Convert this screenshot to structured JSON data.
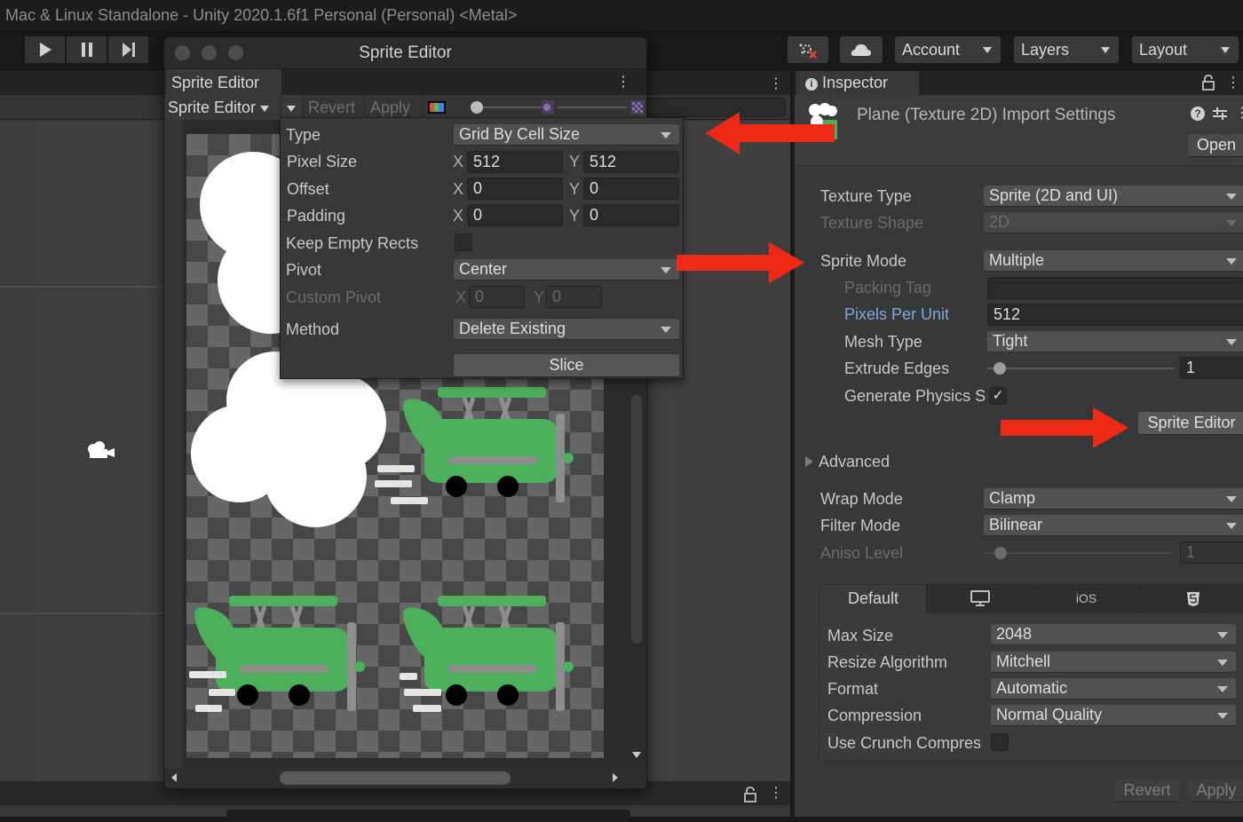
{
  "window_title": "Mac & Linux Standalone - Unity 2020.1.6f1 Personal (Personal) <Metal>",
  "toolbar": {
    "play_icon": "play-icon",
    "pause_icon": "pause-icon",
    "step_icon": "step-icon",
    "collab_icon": "collab-icon",
    "cloud_icon": "cloud-icon",
    "account_label": "Account",
    "layers_label": "Layers",
    "layout_label": "Layout"
  },
  "sprite_editor": {
    "window_title": "Sprite Editor",
    "tab_label": "Sprite Editor",
    "mode_dropdown": "Sprite Editor",
    "slice_menu_icon": "slice-dropdown-icon",
    "revert_label": "Revert",
    "apply_label": "Apply",
    "color_channel_icon": "rgb-channel-icon",
    "zoom_slider_value": 0,
    "mip_slider_value": 0
  },
  "slice_popup": {
    "type_label": "Type",
    "type_value": "Grid By Cell Size",
    "pixel_size_label": "Pixel Size",
    "pixel_size_x": "512",
    "pixel_size_y": "512",
    "offset_label": "Offset",
    "offset_x": "0",
    "offset_y": "0",
    "padding_label": "Padding",
    "padding_x": "0",
    "padding_y": "0",
    "keep_empty_label": "Keep Empty Rects",
    "keep_empty_checked": false,
    "pivot_label": "Pivot",
    "pivot_value": "Center",
    "custom_pivot_label": "Custom Pivot",
    "custom_pivot_x": "0",
    "custom_pivot_y": "0",
    "method_label": "Method",
    "method_value": "Delete Existing",
    "slice_button": "Slice",
    "x_axis": "X",
    "y_axis": "Y"
  },
  "inspector": {
    "tab_label": "Inspector",
    "title": "Plane (Texture 2D) Import Settings",
    "open_button": "Open",
    "fields": {
      "texture_type_label": "Texture Type",
      "texture_type_value": "Sprite (2D and UI)",
      "texture_shape_label": "Texture Shape",
      "texture_shape_value": "2D",
      "sprite_mode_label": "Sprite Mode",
      "sprite_mode_value": "Multiple",
      "packing_tag_label": "Packing Tag",
      "packing_tag_value": "",
      "ppu_label": "Pixels Per Unit",
      "ppu_value": "512",
      "mesh_type_label": "Mesh Type",
      "mesh_type_value": "Tight",
      "extrude_label": "Extrude Edges",
      "extrude_value": "1",
      "gen_physics_label": "Generate Physics S",
      "gen_physics_checked": true,
      "check_mark": "✓",
      "sprite_editor_button": "Sprite Editor",
      "advanced_label": "Advanced",
      "wrap_mode_label": "Wrap Mode",
      "wrap_mode_value": "Clamp",
      "filter_mode_label": "Filter Mode",
      "filter_mode_value": "Bilinear",
      "aniso_label": "Aniso Level",
      "aniso_value": "1"
    },
    "platform_tabs": [
      {
        "label": "Default",
        "icon": ""
      },
      {
        "label": "",
        "icon": "monitor-icon"
      },
      {
        "label": "iOS",
        "icon": ""
      },
      {
        "label": "",
        "icon": "html5-icon"
      }
    ],
    "platform": {
      "max_size_label": "Max Size",
      "max_size_value": "2048",
      "resize_label": "Resize Algorithm",
      "resize_value": "Mitchell",
      "format_label": "Format",
      "format_value": "Automatic",
      "compression_label": "Compression",
      "compression_value": "Normal Quality",
      "crunch_label": "Use Crunch Compres",
      "crunch_checked": false
    },
    "revert_label": "Revert",
    "apply_label": "Apply"
  },
  "annotation_color": "#ee2a16",
  "sprite_green": "#4caf5b"
}
